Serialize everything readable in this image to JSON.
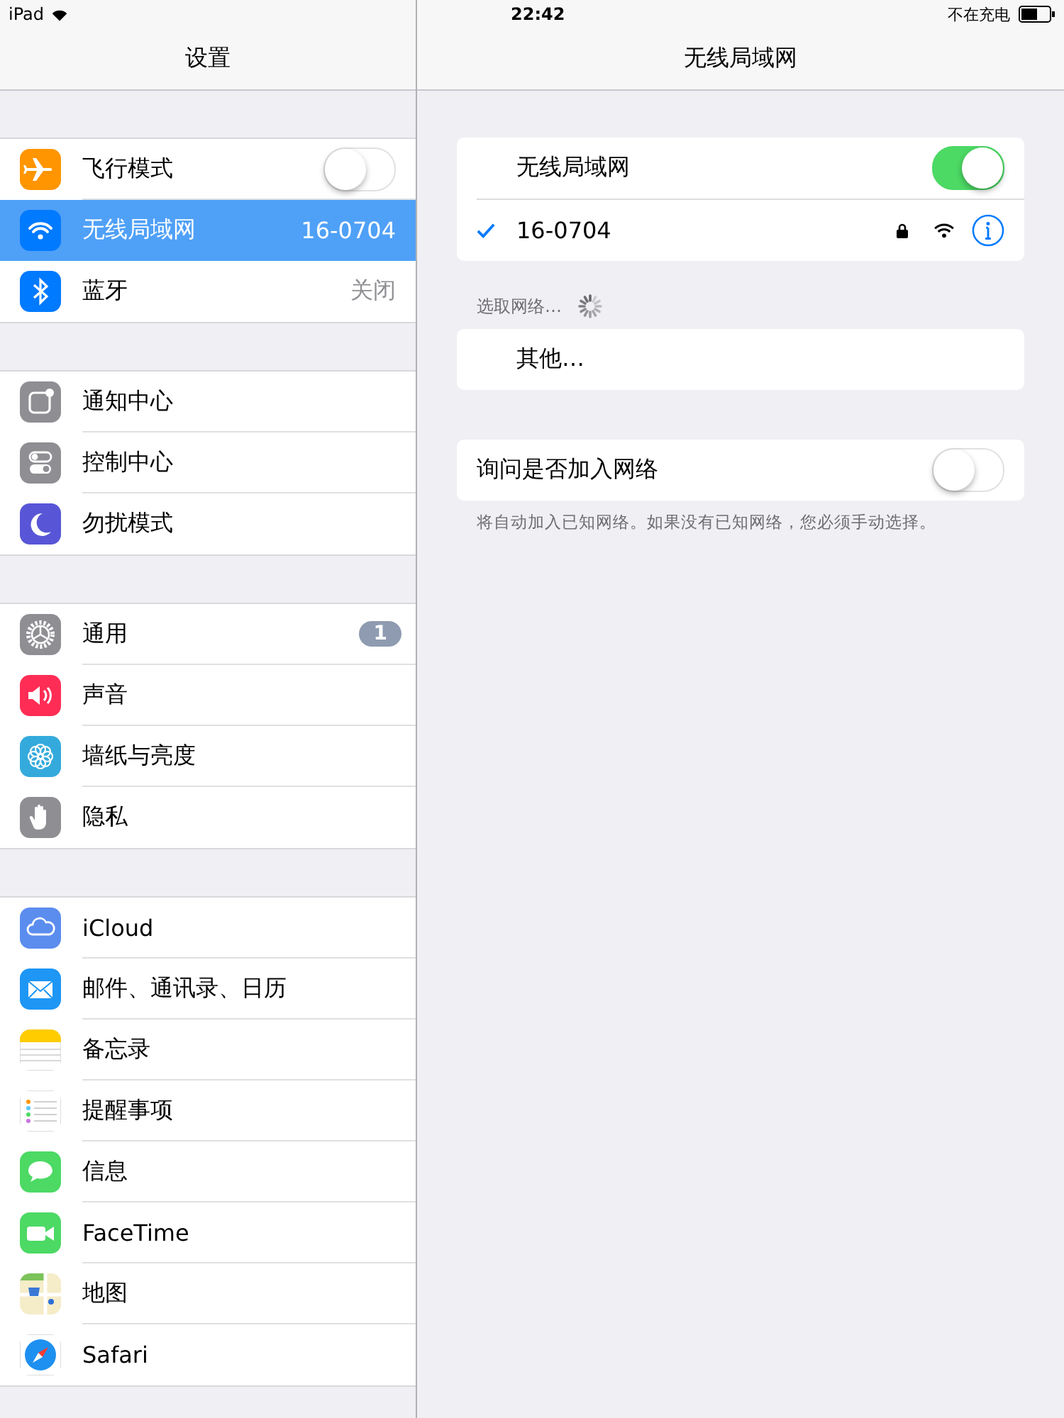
{
  "status_bar": {
    "device": "iPad",
    "time": "22:42",
    "charging": "不在充电"
  },
  "sidebar": {
    "title": "设置",
    "groups": [
      {
        "items": [
          {
            "label": "飞行模式",
            "kind": "toggle",
            "on": false,
            "selected": false
          },
          {
            "label": "无线局域网",
            "kind": "value",
            "value": "16-0704",
            "selected": true
          },
          {
            "label": "蓝牙",
            "kind": "value",
            "value": "关闭",
            "selected": false
          }
        ]
      },
      {
        "items": [
          {
            "label": "通知中心",
            "kind": "plain",
            "selected": false
          },
          {
            "label": "控制中心",
            "kind": "plain",
            "selected": false
          },
          {
            "label": "勿扰模式",
            "kind": "plain",
            "selected": false
          }
        ]
      },
      {
        "items": [
          {
            "label": "通用",
            "kind": "badge",
            "badge": "1",
            "selected": false
          },
          {
            "label": "声音",
            "kind": "plain",
            "selected": false
          },
          {
            "label": "墙纸与亮度",
            "kind": "plain",
            "selected": false
          },
          {
            "label": "隐私",
            "kind": "plain",
            "selected": false
          }
        ]
      },
      {
        "items": [
          {
            "label": "iCloud",
            "kind": "plain",
            "selected": false
          },
          {
            "label": "邮件、通讯录、日历",
            "kind": "plain",
            "selected": false
          },
          {
            "label": "备忘录",
            "kind": "plain",
            "selected": false
          },
          {
            "label": "提醒事项",
            "kind": "plain",
            "selected": false
          },
          {
            "label": "信息",
            "kind": "plain",
            "selected": false
          },
          {
            "label": "FaceTime",
            "kind": "plain",
            "selected": false
          },
          {
            "label": "地图",
            "kind": "plain",
            "selected": false
          },
          {
            "label": "Safari",
            "kind": "plain",
            "selected": false
          }
        ]
      }
    ]
  },
  "detail": {
    "title": "无线局域网",
    "wifi_toggle": {
      "label": "无线局域网",
      "on": true
    },
    "current_network": {
      "name": "16-0704",
      "checked": true
    },
    "section_label": "选取网络…",
    "other": "其他…",
    "ask_to_join": {
      "label": "询问是否加入网络",
      "on": false
    },
    "footer": "将自动加入已知网络。如果没有已知网络，您必须手动选择。"
  }
}
